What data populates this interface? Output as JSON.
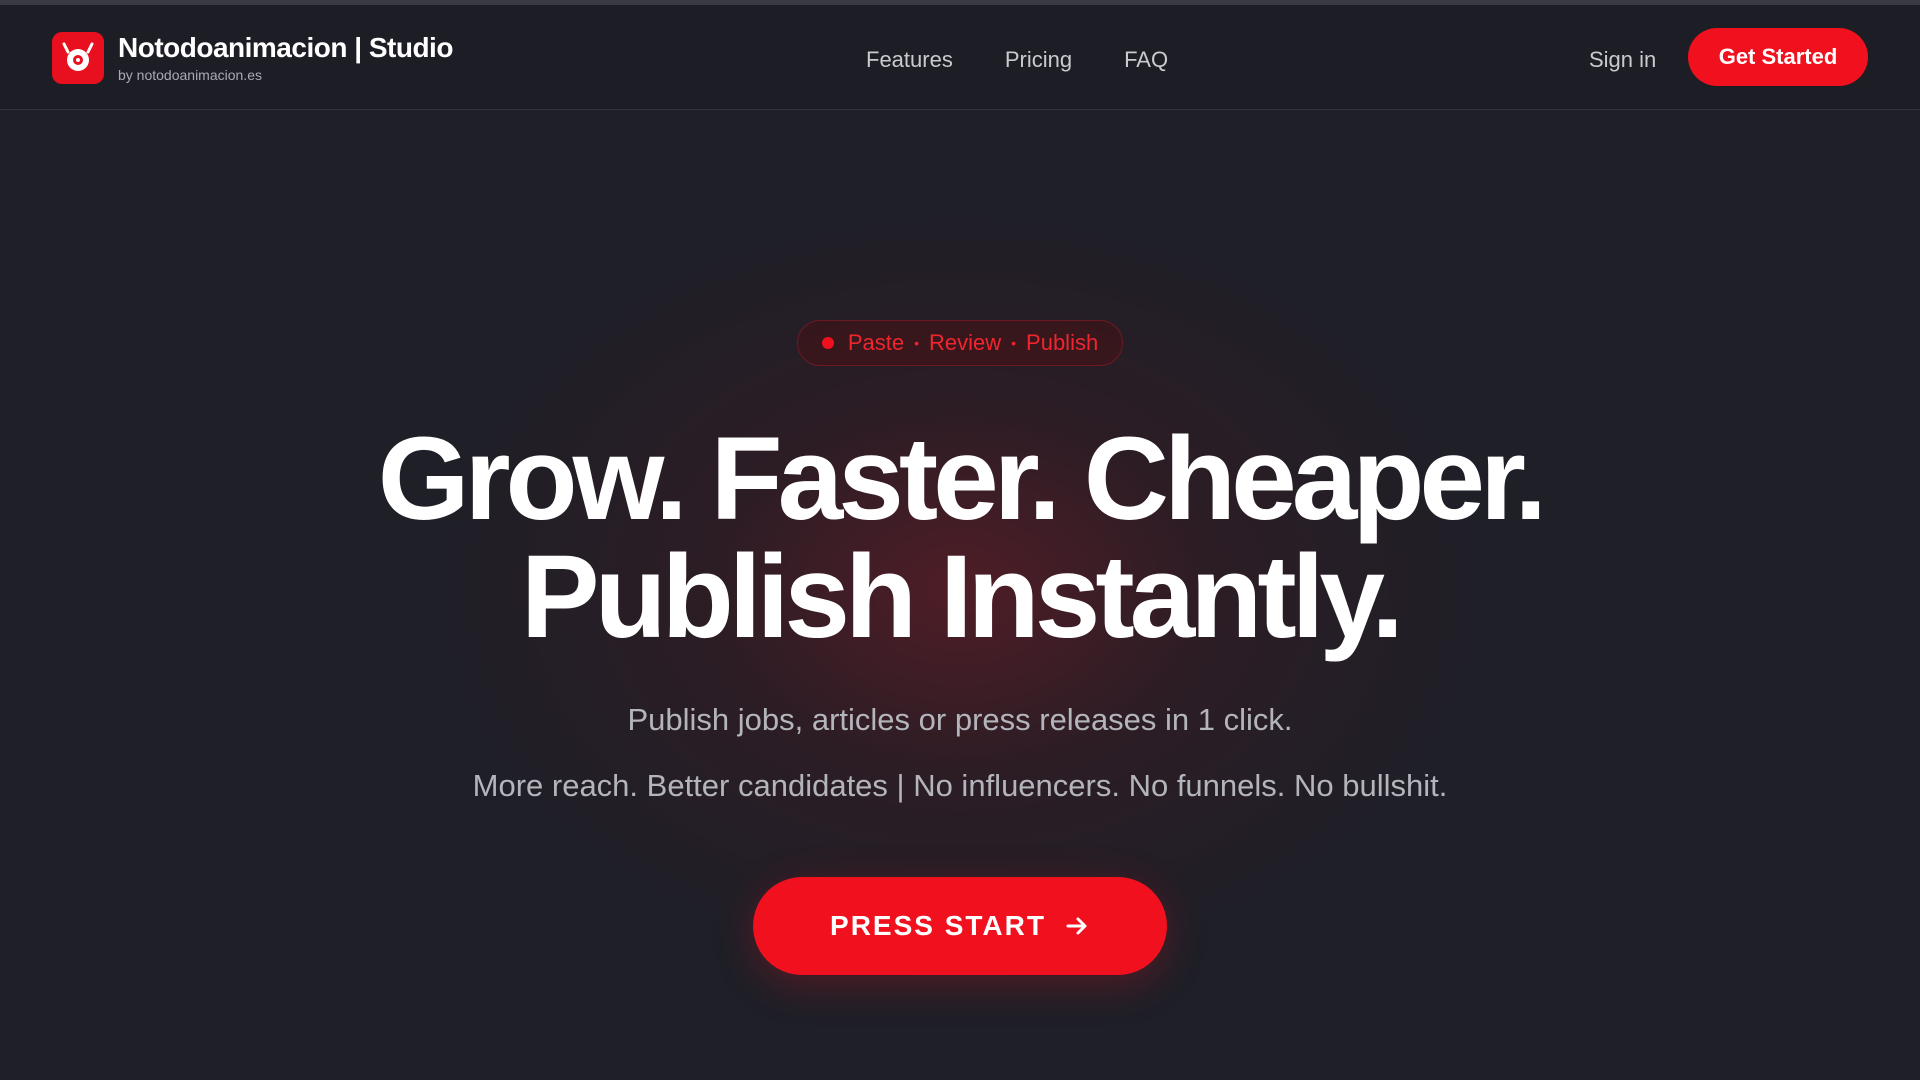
{
  "header": {
    "brand_name": "Notodoanimacion | Studio",
    "brand_sub": "by notodoanimacion.es",
    "logo_icon": "eye-logo-icon",
    "nav": [
      {
        "label": "Features"
      },
      {
        "label": "Pricing"
      },
      {
        "label": "FAQ"
      }
    ],
    "sign_in": "Sign in",
    "get_started": "Get Started"
  },
  "hero": {
    "pill": {
      "step1": "Paste",
      "sep": "•",
      "step2": "Review",
      "step3": "Publish"
    },
    "headline_line1": "Grow. Faster. Cheaper.",
    "headline_line2": "Publish Instantly.",
    "subtitle": "Publish jobs, articles or press releases in 1 click.",
    "tagline": "More reach. Better candidates | No influencers. No funnels. No bullshit.",
    "cta": "PRESS START",
    "cta_icon": "arrow-right-icon"
  },
  "colors": {
    "accent": "#f0101e",
    "background": "#1e1f27",
    "text_muted": "#b4b5bc"
  }
}
